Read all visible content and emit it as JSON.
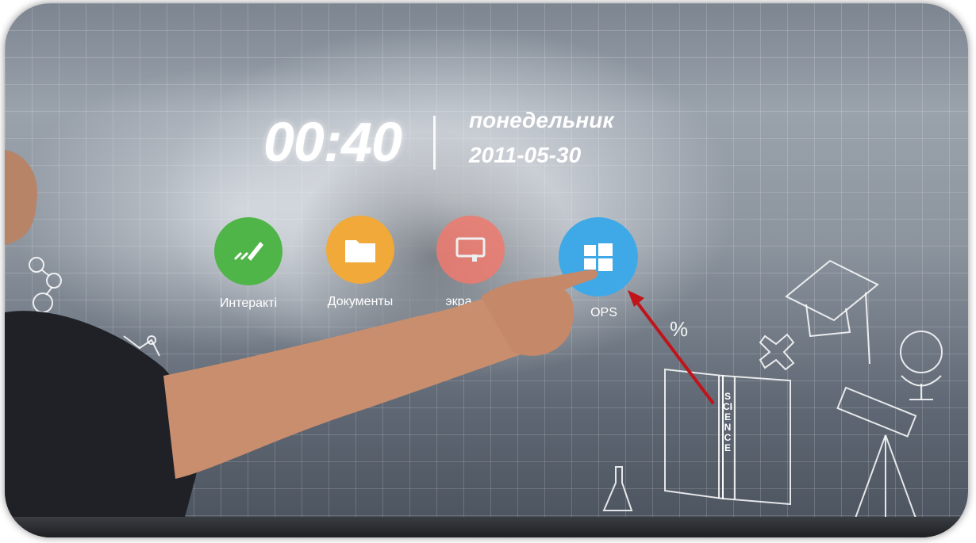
{
  "clock": {
    "time": "00:40",
    "weekday": "понедельник",
    "date": "2011-05-30"
  },
  "apps": [
    {
      "label": "Интеракті",
      "color": "#4fb548",
      "icon": "pen-tablet-icon"
    },
    {
      "label": "Документы",
      "color": "#f1a93a",
      "icon": "folder-icon"
    },
    {
      "label": "экра",
      "color": "#ef7a6e",
      "icon": "screen-icon"
    },
    {
      "label": "OPS",
      "color": "#3fa9e8",
      "icon": "windows-icon"
    }
  ],
  "decor": {
    "book_label": "SCIENCE",
    "percent": "%"
  },
  "annotation": {
    "arrow_color": "#c0141a"
  }
}
